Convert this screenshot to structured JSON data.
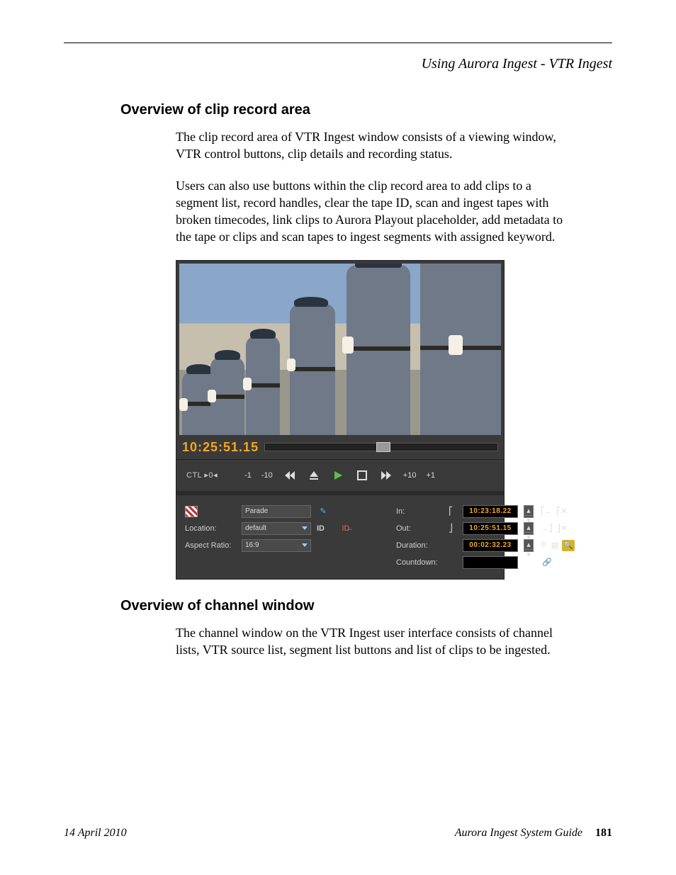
{
  "header": {
    "running": "Using Aurora Ingest - VTR Ingest"
  },
  "sections": [
    {
      "heading": "Overview of clip record area",
      "paras": [
        "The clip record area of VTR Ingest window consists of a viewing window, VTR control buttons, clip details and recording status.",
        "Users can also use buttons within the clip record area to add clips to a segment list, record handles, clear the tape ID, scan and ingest tapes with broken timecodes, link clips to Aurora Playout placeholder, add metadata to the tape or clips and scan tapes to ingest segments with assigned keyword."
      ]
    },
    {
      "heading": "Overview of channel window",
      "paras": [
        "The channel window on the VTR Ingest user interface consists of channel lists, VTR source list, segment list buttons and list of clips to be ingested."
      ]
    }
  ],
  "app": {
    "timecode": "10:25:51.15",
    "ctl_label": "CTL ▸0◂",
    "transport": {
      "back1": "-1",
      "back10": "-10",
      "fwd10": "+10",
      "fwd1": "+1"
    },
    "fields": {
      "name_value": "Parade",
      "location_label": "Location:",
      "location_value": "default",
      "aspect_label": "Aspect Ratio:",
      "aspect_value": "16:9",
      "id_label": "ID",
      "in_label": "In:",
      "in_value": "10:23:18.22",
      "out_label": "Out:",
      "out_value": "10:25:51.15",
      "dur_label": "Duration:",
      "dur_value": "00:02:32.23",
      "count_label": "Countdown:",
      "count_value": ""
    }
  },
  "footer": {
    "date": "14 April 2010",
    "title": "Aurora Ingest System Guide",
    "page": "181"
  }
}
